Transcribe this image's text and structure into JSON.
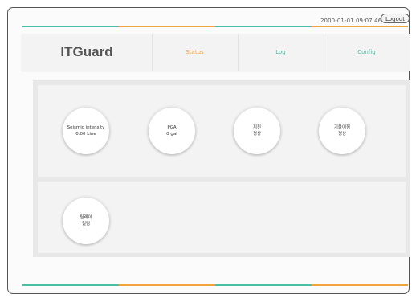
{
  "header": {
    "datetime": "2000-01-01 09:07:46",
    "logout_label": "Logout"
  },
  "nav": {
    "brand": "ITGuard",
    "tabs": [
      {
        "label": "Status",
        "active": true
      },
      {
        "label": "Log",
        "active": false
      },
      {
        "label": "Config",
        "active": false
      }
    ]
  },
  "status": {
    "tiles": [
      {
        "label": "Seismic intensity",
        "value": "0.00 kine"
      },
      {
        "label": "PGA",
        "value": "0 gal"
      },
      {
        "label": "지진",
        "value": "정상"
      },
      {
        "label": "기울어짐",
        "value": "정상"
      },
      {
        "label": "릴레이",
        "value": "열림"
      }
    ]
  },
  "colors": {
    "accent_teal": "#4bbfa6",
    "accent_orange": "#f0a23c"
  }
}
